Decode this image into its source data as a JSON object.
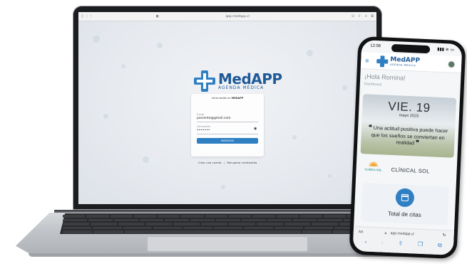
{
  "laptop": {
    "browser": {
      "url": "app.medapp.cl",
      "icons_left": [
        "sidebar-icon",
        "back-icon",
        "forward-icon"
      ],
      "icons_right": [
        "download-icon",
        "share-icon",
        "new-tab-icon",
        "tabs-icon"
      ]
    },
    "brand": {
      "name": "MedAPP",
      "subtitle": "AGENDA MÉDICA"
    },
    "login": {
      "header": "Inicia sesión en ",
      "header_brand": "MEDAPP",
      "email_label": "E-mail",
      "email_value": "paciente@gmail.com",
      "password_label": "Contraseña",
      "password_value": "•••••••",
      "submit_label": "INGRESAR",
      "create_account": "Crear una cuenta",
      "separator": "|",
      "recover_password": "Recuperar contraseña"
    },
    "accent": "#2f7fc3"
  },
  "phone": {
    "status": {
      "time": "12:56",
      "indicators": "▮▮▮ ≋ ▭"
    },
    "brand": {
      "name": "MedAPP",
      "subtitle": "AGENDA MÉDICA"
    },
    "greeting": "¡Hola Romina!",
    "breadcrumb": "Dashboard",
    "quote_card": {
      "day": "VIE. 19",
      "date": "mayo 2023",
      "open_quote": "❝",
      "quote": "Una actitud positiva puede hacer que los sueños se conviertan en realidad",
      "close_quote": "❞"
    },
    "clinic": {
      "logo_text": "CLÍNICA SOL",
      "name": "CLÍNICAL SOL"
    },
    "citas": {
      "label": "Total de citas"
    },
    "url_bar": {
      "aa": "AA",
      "url": "app.medapp.cl"
    },
    "nav_icons": [
      "back-icon",
      "forward-icon",
      "share-icon",
      "bookmarks-icon",
      "tabs-icon"
    ]
  }
}
